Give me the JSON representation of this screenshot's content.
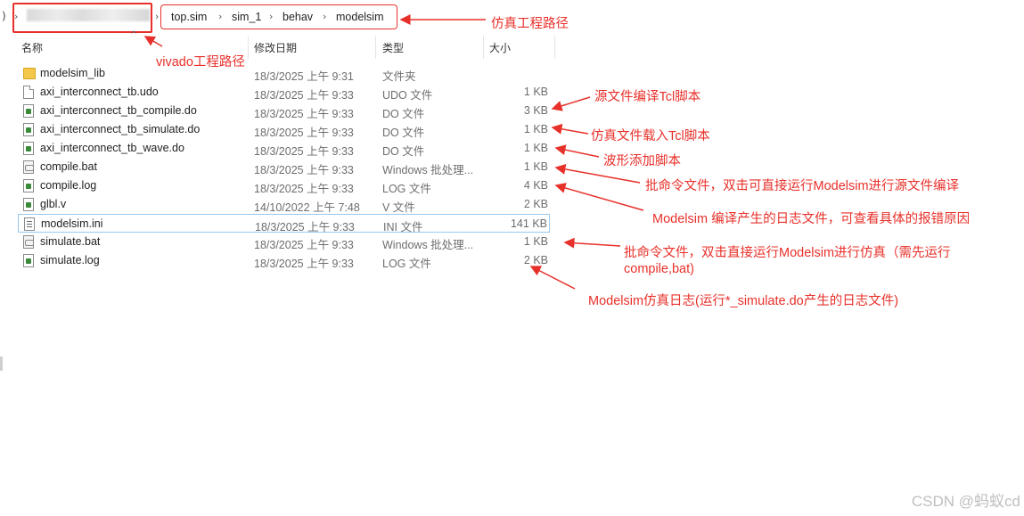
{
  "breadcrumb": {
    "segments": [
      "top.sim",
      "sim_1",
      "behav",
      "modelsim"
    ]
  },
  "columns": {
    "name": "名称",
    "date": "修改日期",
    "type": "类型",
    "size": "大小"
  },
  "files": [
    {
      "name": "modelsim_lib",
      "date": "18/3/2025 上午 9:31",
      "type": "文件夹",
      "size": "",
      "icon": "folder-icon"
    },
    {
      "name": "axi_interconnect_tb.udo",
      "date": "18/3/2025 上午 9:33",
      "type": "UDO 文件",
      "size": "1 KB",
      "icon": "file-icon"
    },
    {
      "name": "axi_interconnect_tb_compile.do",
      "date": "18/3/2025 上午 9:33",
      "type": "DO 文件",
      "size": "3 KB",
      "icon": "tcl-file-icon"
    },
    {
      "name": "axi_interconnect_tb_simulate.do",
      "date": "18/3/2025 上午 9:33",
      "type": "DO 文件",
      "size": "1 KB",
      "icon": "tcl-file-icon"
    },
    {
      "name": "axi_interconnect_tb_wave.do",
      "date": "18/3/2025 上午 9:33",
      "type": "DO 文件",
      "size": "1 KB",
      "icon": "tcl-file-icon"
    },
    {
      "name": "compile.bat",
      "date": "18/3/2025 上午 9:33",
      "type": "Windows 批处理...",
      "size": "1 KB",
      "icon": "batch-file-icon"
    },
    {
      "name": "compile.log",
      "date": "18/3/2025 上午 9:33",
      "type": "LOG 文件",
      "size": "4 KB",
      "icon": "tcl-file-icon"
    },
    {
      "name": "glbl.v",
      "date": "14/10/2022 上午 7:48",
      "type": "V 文件",
      "size": "2 KB",
      "icon": "tcl-file-icon"
    },
    {
      "name": "modelsim.ini",
      "date": "18/3/2025 上午 9:33",
      "type": "INI 文件",
      "size": "141 KB",
      "icon": "ini-file-icon"
    },
    {
      "name": "simulate.bat",
      "date": "18/3/2025 上午 9:33",
      "type": "Windows 批处理...",
      "size": "1 KB",
      "icon": "batch-file-icon"
    },
    {
      "name": "simulate.log",
      "date": "18/3/2025 上午 9:33",
      "type": "LOG 文件",
      "size": "2 KB",
      "icon": "tcl-file-icon"
    }
  ],
  "annotations": {
    "sim_path": "仿真工程路径",
    "vivado_path": "vivado工程路径",
    "compile_do": "源文件编译Tcl脚本",
    "simulate_do": "仿真文件载入Tcl脚本",
    "wave_do": "波形添加脚本",
    "compile_bat": "批命令文件，双击可直接运行Modelsim进行源文件编译",
    "compile_log": "Modelsim 编译产生的日志文件，可查看具体的报错原因",
    "simulate_bat_1": "批命令文件，双击直接运行Modelsim进行仿真（需先运行",
    "simulate_bat_2": "compile,bat)",
    "simulate_log": "Modelsim仿真日志(运行*_simulate.do产生的日志文件)"
  },
  "watermark": "CSDN @蚂蚁cd",
  "colors": {
    "annotation": "#e8302a",
    "selection_border": "#99c9ef",
    "folder": "#f3c84a"
  }
}
